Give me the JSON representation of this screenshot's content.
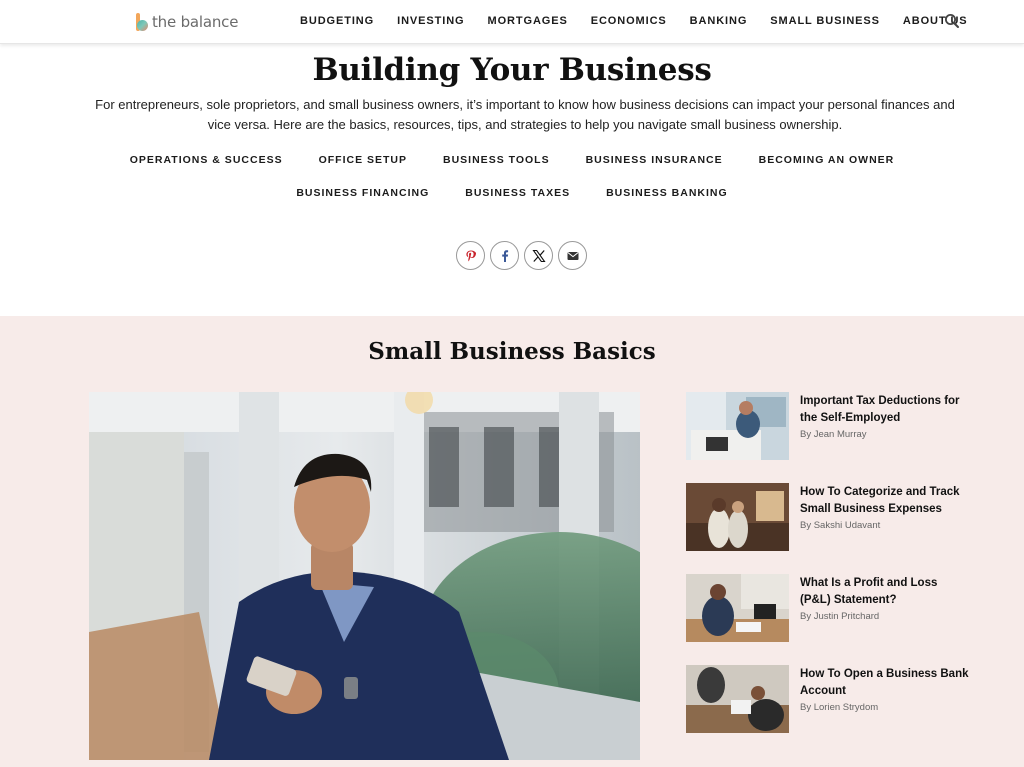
{
  "header": {
    "logo_text": "the balance",
    "nav": [
      "BUDGETING",
      "INVESTING",
      "MORTGAGES",
      "ECONOMICS",
      "BANKING",
      "SMALL BUSINESS",
      "ABOUT US"
    ],
    "search_icon": "search-icon"
  },
  "hero": {
    "title": "Building Your Business",
    "intro": "For entrepreneurs, sole proprietors, and small business owners, it’s important to know how business decisions can impact your personal finances and vice versa. Here are the basics, resources, tips, and strategies to help you navigate small business ownership.",
    "categories_row1": [
      "OPERATIONS & SUCCESS",
      "OFFICE SETUP",
      "BUSINESS TOOLS",
      "BUSINESS INSURANCE",
      "BECOMING AN OWNER"
    ],
    "categories_row2": [
      "BUSINESS FINANCING",
      "BUSINESS TAXES",
      "BUSINESS BANKING"
    ],
    "share_icons": [
      "pinterest-icon",
      "facebook-icon",
      "x-icon",
      "email-icon"
    ]
  },
  "basics": {
    "title": "Small Business Basics",
    "articles": [
      {
        "title": "Important Tax Deductions for the Self-Employed",
        "byline": "By Jean Murray"
      },
      {
        "title": "How To Categorize and Track Small Business Expenses",
        "byline": "By Sakshi Udavant"
      },
      {
        "title": "What Is a Profit and Loss (P&L) Statement?",
        "byline": "By Justin Pritchard"
      },
      {
        "title": "How To Open a Business Bank Account",
        "byline": "By Lorien Strydom"
      }
    ]
  },
  "colors": {
    "section_bg": "#f7ebe9",
    "text": "#1b1b1b",
    "pinterest": "#c8232c",
    "facebook": "#3b5998"
  }
}
